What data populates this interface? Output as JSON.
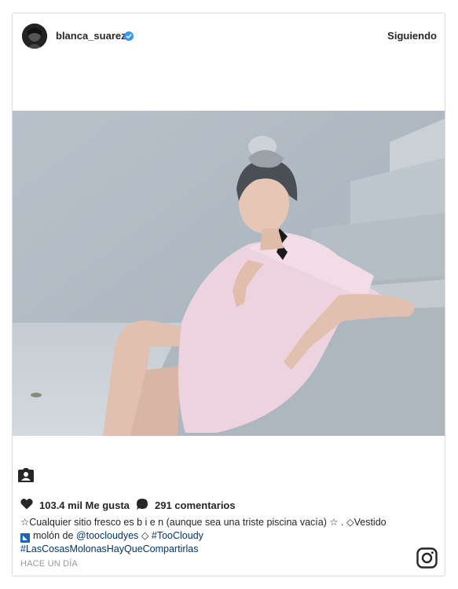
{
  "post": {
    "username": "blanca_suarez",
    "follow_status": "Siguiendo",
    "likes": "103.4 mil Me gusta",
    "comments": "291 comentarios",
    "caption": {
      "line1": "☆Cualquier sitio fresco es b i e n (aunque sea una triste piscina vacía) ☆ . ◇Vestido",
      "line2_prefix": "molón de ",
      "mention": "@toocloudyes",
      "line2_middle": " ◇ ",
      "hashtag1": "#TooCloudy",
      "hashtag2": "#LasCosasMolonasHayQueCompartirlas"
    },
    "timestamp": "HACE UN DÍA"
  },
  "icons": {
    "verified": "verified-badge-icon",
    "tag": "user-tag-icon",
    "like": "heart-icon",
    "comment": "comment-bubble-icon",
    "brand": "instagram-logo-icon",
    "flag": "flag-emoji-icon"
  },
  "colors": {
    "verified": "#3897f0",
    "link": "#003569",
    "text": "#262626",
    "muted": "#999999",
    "border": "#dbdbdb"
  }
}
